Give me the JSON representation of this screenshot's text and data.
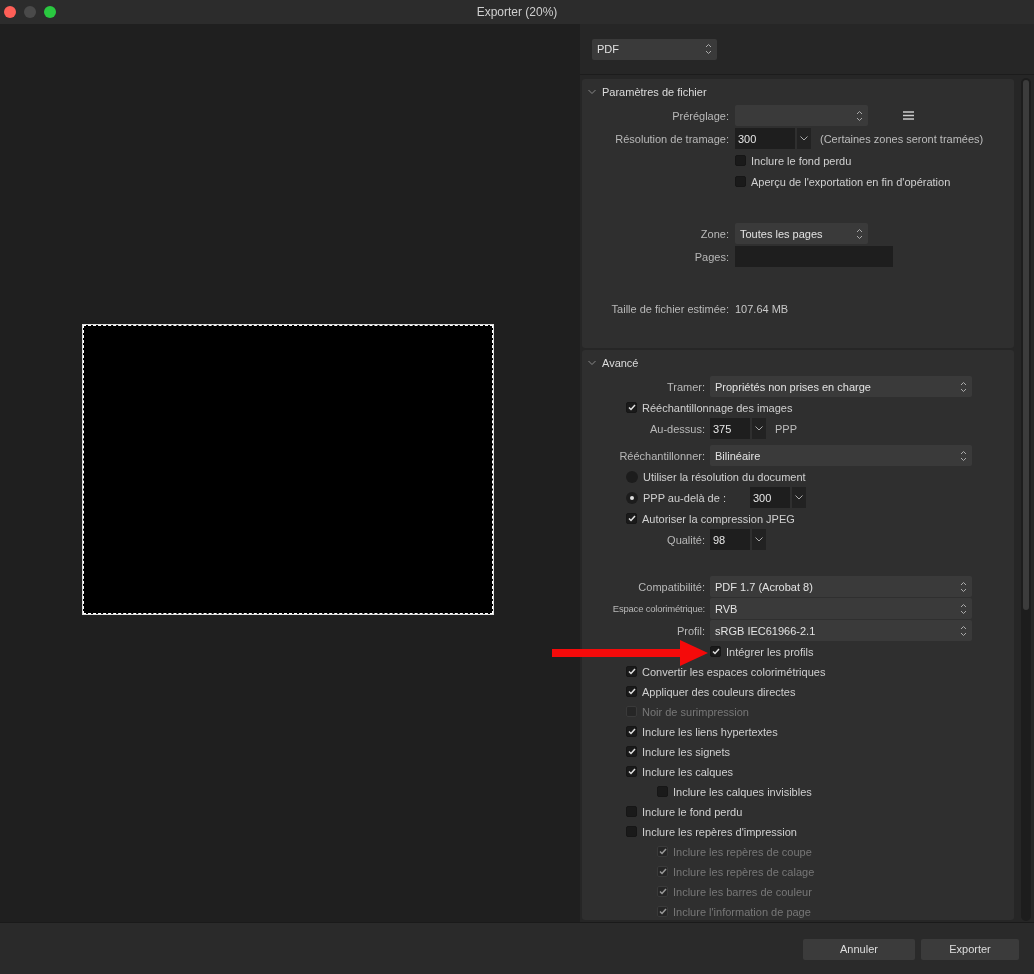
{
  "window": {
    "title": "Exporter (20%)"
  },
  "format": {
    "value": "PDF"
  },
  "file_settings": {
    "title": "Paramètres de fichier",
    "expanded": true,
    "groups": [
      {
        "rows": [
          {
            "kind": "select",
            "label": "Préréglage:",
            "menu": true
          },
          {
            "kind": "spinner",
            "label": "Résolution de tramage:",
            "value": "300",
            "note": "(Certaines zones seront tramées)",
            "children": [
              {
                "kind": "checkbox",
                "label": "Inclure le fond perdu",
                "checked": false,
                "disabled": false
              },
              {
                "kind": "checkbox",
                "label": "Aperçu de l'exportation en fin d'opération",
                "checked": false,
                "disabled": false
              }
            ]
          }
        ]
      },
      {
        "rows": [
          {
            "kind": "select",
            "label": "Zone:",
            "value": "Toutes les pages"
          },
          {
            "kind": "field",
            "label": "Pages:"
          }
        ]
      },
      {
        "rows": [
          {
            "kind": "info",
            "label": "Taille de fichier estimée:",
            "value": "107.64 MB"
          }
        ]
      }
    ]
  },
  "advanced": {
    "title": "Avancé",
    "expanded": true,
    "groups": [
      {
        "rows": [
          {
            "kind": "select",
            "label": "Tramer:",
            "value": "Propriétés non prises en charge"
          },
          {
            "kind": "checkbox",
            "label": "Rééchantillonnage des images",
            "checked": true,
            "disabled": false
          },
          {
            "kind": "spinner",
            "label": "Au-dessus:",
            "value": "375",
            "note": "PPP"
          }
        ]
      },
      {
        "rows": [
          {
            "kind": "select",
            "label": "Rééchantillonner:",
            "value": "Bilinéaire"
          },
          {
            "kind": "radio",
            "label": "Utiliser la résolution du document",
            "selected": false
          },
          {
            "kind": "radio",
            "label": "PPP au-delà de :",
            "selected": true,
            "value": "300"
          },
          {
            "kind": "checkbox",
            "label": "Autoriser la compression JPEG",
            "checked": true,
            "disabled": false
          },
          {
            "kind": "spinner",
            "label": "Qualité:",
            "value": "98"
          }
        ]
      },
      {
        "rows": [
          {
            "kind": "select",
            "label": "Compatibilité:",
            "value": "PDF 1.7 (Acrobat 8)"
          },
          {
            "kind": "select",
            "label": "Espace colorimétrique:",
            "value": "RVB"
          },
          {
            "kind": "select",
            "label": "Profil:",
            "value": "sRGB IEC61966-2.1",
            "children": [
              {
                "kind": "checkbox",
                "label": "Intégrer les profils",
                "checked": true,
                "disabled": false
              }
            ]
          },
          {
            "kind": "checkbox",
            "label": "Convertir les espaces colorimétriques",
            "checked": true,
            "disabled": false
          },
          {
            "kind": "checkbox",
            "label": "Appliquer des couleurs directes",
            "checked": true,
            "disabled": false
          },
          {
            "kind": "checkbox",
            "label": "Noir de surimpression",
            "checked": false,
            "disabled": true
          },
          {
            "kind": "checkbox",
            "label": "Inclure les liens hypertextes",
            "checked": true,
            "disabled": false
          },
          {
            "kind": "checkbox",
            "label": "Inclure les signets",
            "checked": true,
            "disabled": false
          },
          {
            "kind": "checkbox",
            "label": "Inclure les calques",
            "checked": true,
            "disabled": false,
            "children": [
              {
                "kind": "checkbox",
                "label": "Inclure les calques invisibles",
                "checked": false,
                "disabled": false
              }
            ]
          },
          {
            "kind": "checkbox",
            "label": "Inclure le fond perdu",
            "checked": false,
            "disabled": false
          },
          {
            "kind": "checkbox",
            "label": "Inclure les repères d'impression",
            "checked": false,
            "disabled": false,
            "children": [
              {
                "kind": "checkbox",
                "label": "Inclure les repères de coupe",
                "checked": true,
                "disabled": true
              },
              {
                "kind": "checkbox",
                "label": "Inclure les repères de calage",
                "checked": true,
                "disabled": true
              },
              {
                "kind": "checkbox",
                "label": "Inclure les barres de couleur",
                "checked": true,
                "disabled": true
              },
              {
                "kind": "checkbox",
                "label": "Inclure l'information de page",
                "checked": true,
                "disabled": true
              }
            ]
          }
        ]
      }
    ]
  },
  "buttons": [
    {
      "label": "Annuler"
    },
    {
      "label": "Exporter"
    }
  ]
}
